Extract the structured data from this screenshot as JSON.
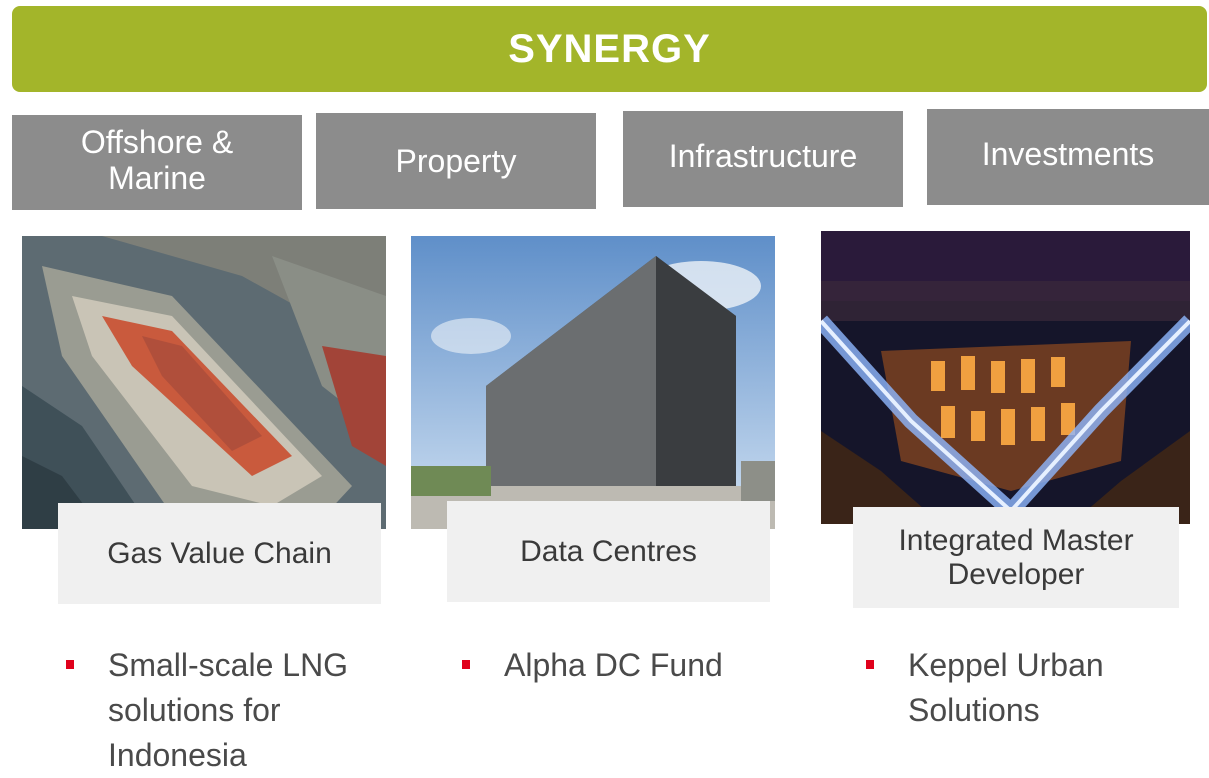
{
  "banner": {
    "title": "SYNERGY",
    "color": "#a3b52a"
  },
  "segments": [
    {
      "label": "Offshore & Marine"
    },
    {
      "label": "Property"
    },
    {
      "label": "Infrastructure"
    },
    {
      "label": "Investments"
    }
  ],
  "cards": [
    {
      "caption": "Gas Value Chain",
      "bullet": "Small-scale LNG solutions for Indonesia"
    },
    {
      "caption": "Data Centres",
      "bullet": "Alpha DC Fund"
    },
    {
      "caption": "Integrated Master Developer",
      "bullet": "Keppel Urban Solutions"
    }
  ],
  "colors": {
    "segment_bg": "#8c8c8c",
    "caption_bg": "#f0f0f0",
    "bullet_mark": "#e0001b"
  }
}
